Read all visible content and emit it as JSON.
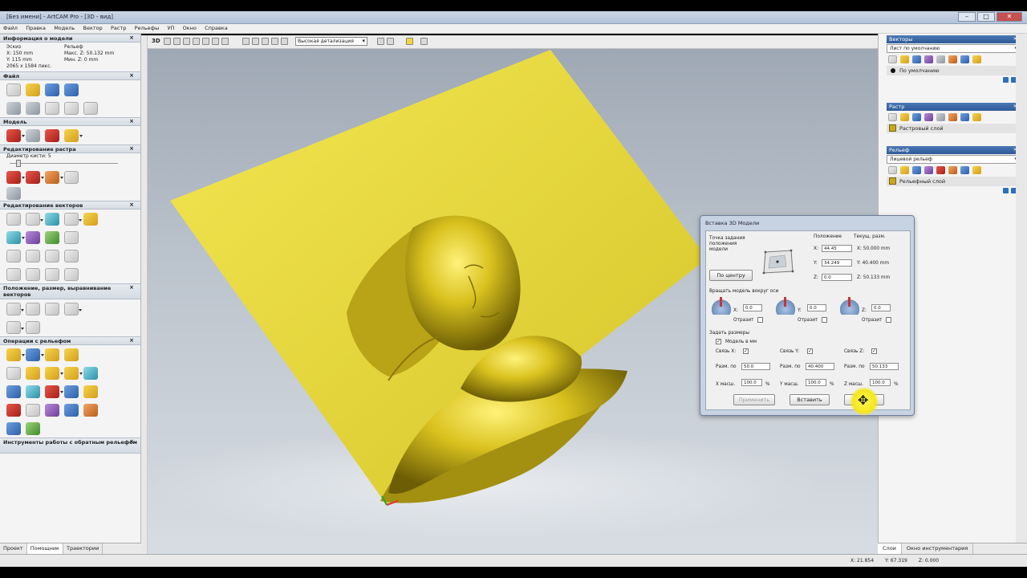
{
  "window": {
    "title": "[Без имени] - ArtCAM Pro - [3D - вид]"
  },
  "menu": [
    "Файл",
    "Правка",
    "Модель",
    "Вектор",
    "Растр",
    "Рельефы",
    "УП",
    "Окно",
    "Справка"
  ],
  "left_panel": {
    "model_info_title": "Информация о модели",
    "sketch_label": "Эскиз",
    "relief_label": "Рельеф",
    "x_size": "X: 150 mm",
    "y_size": "Y: 115 mm",
    "pixels": "2065 x 1584 пикс.",
    "max_z": "Макс. Z: 50.132 mm",
    "min_z": "Мин. Z: 0 mm",
    "file_title": "Файл",
    "model_title": "Модель",
    "raster_edit_title": "Редактирование растра",
    "brush_label": "Диаметр кисти:",
    "brush_value": "5",
    "vector_edit_title": "Редактирование векторов",
    "position_title": "Положение, размер, выравнивание векторов",
    "relief_ops_title": "Операции с рельефом",
    "reverse_tools_title": "Инструменты работы с обратным рельефом",
    "tabs": [
      "Проект",
      "Помощник",
      "Траектории"
    ]
  },
  "viewport": {
    "mode_label": "3D",
    "detail_select": "Высокая детализация",
    "colors": {
      "plane": "#e8d83a",
      "bust": "#d9c21e",
      "sky_top": "#9da7b3",
      "sky_bottom": "#d8dde3"
    }
  },
  "right_panel": {
    "vectors_title": "Векторы",
    "vectors_select": "Лист по умолчанию",
    "vectors_item": "По умолчанию",
    "raster_title": "Растр",
    "raster_item": "Растровый слой",
    "relief_title": "Рельеф",
    "relief_select": "Лицевой рельеф",
    "relief_item": "Рельефный слой",
    "tabs": [
      "Слои",
      "Окно инструментария"
    ]
  },
  "status": {
    "x": "X: 21.854",
    "y": "Y: 67.319",
    "z": "Z: 0.000"
  },
  "dialog": {
    "title": "Вставка 3D Модели",
    "anchor_label_1": "Точка задания",
    "anchor_label_2": "положения",
    "anchor_label_3": "модели",
    "center_button": "По центру",
    "position_header": "Положение",
    "current_size_header": "Текущ. разм.",
    "pos_x": "44.45",
    "pos_y": "34.249",
    "pos_z": "0.0",
    "size_x": "X: 50.000 mm",
    "size_y": "Y: 40.400 mm",
    "size_z": "Z: 50.133 mm",
    "rotate_title": "Вращать модель вокруг оси",
    "rot_x": "0.0",
    "rot_y": "0.0",
    "rot_z": "0.0",
    "mirror_label": "Отразит",
    "set_size_title": "Задать размеры",
    "model_in_mm": "Модель в мм",
    "link_x": "Связь X:",
    "link_y": "Связь Y:",
    "link_z": "Связь Z:",
    "size_label": "Разм. по",
    "size_x_val": "50.0",
    "size_y_val": "40.400",
    "size_z_val": "50.133",
    "scale_x_label": "X масш.",
    "scale_y_label": "Y масш.",
    "scale_z_label": "Z масш.",
    "scale_x": "100.0",
    "scale_y": "100.0",
    "scale_z": "100.0",
    "percent": "%",
    "apply_button": "Применить",
    "insert_button": "Вставить",
    "close_button": "Закрыть"
  }
}
